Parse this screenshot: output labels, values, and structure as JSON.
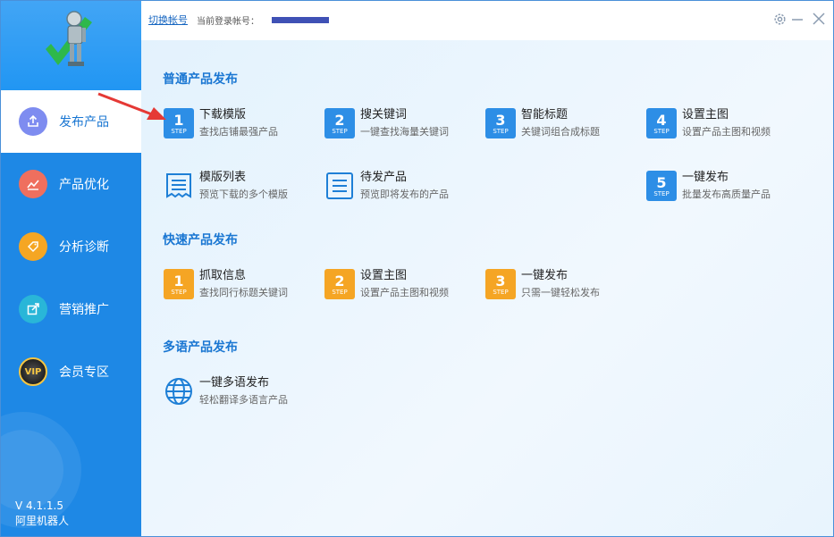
{
  "topbar": {
    "switch_account": "切换帐号",
    "login_label": "当前登录帐号："
  },
  "sidebar": {
    "items": [
      {
        "label": "发布产品",
        "icon": "upload-icon",
        "color": "#7e8cf0"
      },
      {
        "label": "产品优化",
        "icon": "chart-icon",
        "color": "#ef6f5e"
      },
      {
        "label": "分析诊断",
        "icon": "tag-icon",
        "color": "#f5a623"
      },
      {
        "label": "营销推广",
        "icon": "share-icon",
        "color": "#29b6d8"
      },
      {
        "label": "会员专区",
        "icon": "vip-icon",
        "color": "#333333"
      }
    ],
    "version": "V 4.1.1.5",
    "app_name": "阿里机器人"
  },
  "sections": [
    {
      "title": "普通产品发布",
      "tiles": [
        {
          "step": "1",
          "step_label": "STEP",
          "title": "下载模版",
          "desc": "查找店铺最强产品"
        },
        {
          "step": "2",
          "step_label": "STEP",
          "title": "搜关键词",
          "desc": "一键查找海量关键词"
        },
        {
          "step": "3",
          "step_label": "STEP",
          "title": "智能标题",
          "desc": "关键词组合成标题"
        },
        {
          "step": "4",
          "step_label": "STEP",
          "title": "设置主图",
          "desc": "设置产品主图和视频"
        },
        {
          "icon": "template-list-icon",
          "title": "模版列表",
          "desc": "预览下载的多个模版"
        },
        {
          "icon": "pending-list-icon",
          "title": "待发产品",
          "desc": "预览即将发布的产品"
        },
        {
          "step": "5",
          "step_label": "STEP",
          "title": "一键发布",
          "desc": "批量发布高质量产品"
        }
      ]
    },
    {
      "title": "快速产品发布",
      "tiles": [
        {
          "step": "1",
          "step_label": "STEP",
          "title": "抓取信息",
          "desc": "查找同行标题关键词"
        },
        {
          "step": "2",
          "step_label": "STEP",
          "title": "设置主图",
          "desc": "设置产品主图和视频"
        },
        {
          "step": "3",
          "step_label": "STEP",
          "title": "一键发布",
          "desc": "只需一键轻松发布"
        }
      ]
    },
    {
      "title": "多语产品发布",
      "tiles": [
        {
          "icon": "globe-icon",
          "title": "一键多语发布",
          "desc": "轻松翻译多语言产品"
        }
      ]
    }
  ],
  "colors": {
    "sidebar": "#1e88e5",
    "accent": "#1976d2",
    "step_blue": "#2d8ee6",
    "step_orange": "#f5a524"
  }
}
